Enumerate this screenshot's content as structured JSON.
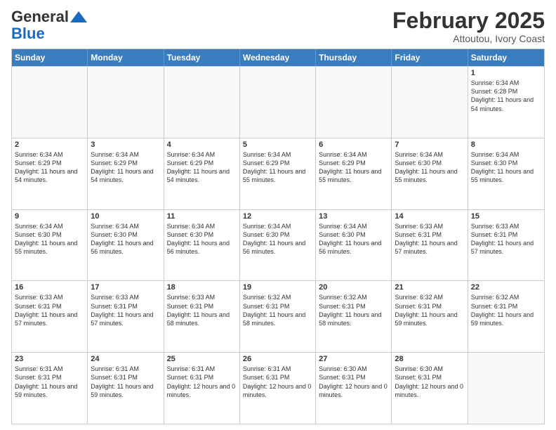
{
  "header": {
    "logo_general": "General",
    "logo_blue": "Blue",
    "month_title": "February 2025",
    "location": "Attoutou, Ivory Coast"
  },
  "days_of_week": [
    "Sunday",
    "Monday",
    "Tuesday",
    "Wednesday",
    "Thursday",
    "Friday",
    "Saturday"
  ],
  "weeks": [
    [
      {
        "day": "",
        "info": "",
        "empty": true
      },
      {
        "day": "",
        "info": "",
        "empty": true
      },
      {
        "day": "",
        "info": "",
        "empty": true
      },
      {
        "day": "",
        "info": "",
        "empty": true
      },
      {
        "day": "",
        "info": "",
        "empty": true
      },
      {
        "day": "",
        "info": "",
        "empty": true
      },
      {
        "day": "1",
        "info": "Sunrise: 6:34 AM\nSunset: 6:28 PM\nDaylight: 11 hours and 54 minutes."
      }
    ],
    [
      {
        "day": "2",
        "info": "Sunrise: 6:34 AM\nSunset: 6:29 PM\nDaylight: 11 hours and 54 minutes."
      },
      {
        "day": "3",
        "info": "Sunrise: 6:34 AM\nSunset: 6:29 PM\nDaylight: 11 hours and 54 minutes."
      },
      {
        "day": "4",
        "info": "Sunrise: 6:34 AM\nSunset: 6:29 PM\nDaylight: 11 hours and 54 minutes."
      },
      {
        "day": "5",
        "info": "Sunrise: 6:34 AM\nSunset: 6:29 PM\nDaylight: 11 hours and 55 minutes."
      },
      {
        "day": "6",
        "info": "Sunrise: 6:34 AM\nSunset: 6:29 PM\nDaylight: 11 hours and 55 minutes."
      },
      {
        "day": "7",
        "info": "Sunrise: 6:34 AM\nSunset: 6:30 PM\nDaylight: 11 hours and 55 minutes."
      },
      {
        "day": "8",
        "info": "Sunrise: 6:34 AM\nSunset: 6:30 PM\nDaylight: 11 hours and 55 minutes."
      }
    ],
    [
      {
        "day": "9",
        "info": "Sunrise: 6:34 AM\nSunset: 6:30 PM\nDaylight: 11 hours and 55 minutes."
      },
      {
        "day": "10",
        "info": "Sunrise: 6:34 AM\nSunset: 6:30 PM\nDaylight: 11 hours and 56 minutes."
      },
      {
        "day": "11",
        "info": "Sunrise: 6:34 AM\nSunset: 6:30 PM\nDaylight: 11 hours and 56 minutes."
      },
      {
        "day": "12",
        "info": "Sunrise: 6:34 AM\nSunset: 6:30 PM\nDaylight: 11 hours and 56 minutes."
      },
      {
        "day": "13",
        "info": "Sunrise: 6:34 AM\nSunset: 6:30 PM\nDaylight: 11 hours and 56 minutes."
      },
      {
        "day": "14",
        "info": "Sunrise: 6:33 AM\nSunset: 6:31 PM\nDaylight: 11 hours and 57 minutes."
      },
      {
        "day": "15",
        "info": "Sunrise: 6:33 AM\nSunset: 6:31 PM\nDaylight: 11 hours and 57 minutes."
      }
    ],
    [
      {
        "day": "16",
        "info": "Sunrise: 6:33 AM\nSunset: 6:31 PM\nDaylight: 11 hours and 57 minutes."
      },
      {
        "day": "17",
        "info": "Sunrise: 6:33 AM\nSunset: 6:31 PM\nDaylight: 11 hours and 57 minutes."
      },
      {
        "day": "18",
        "info": "Sunrise: 6:33 AM\nSunset: 6:31 PM\nDaylight: 11 hours and 58 minutes."
      },
      {
        "day": "19",
        "info": "Sunrise: 6:32 AM\nSunset: 6:31 PM\nDaylight: 11 hours and 58 minutes."
      },
      {
        "day": "20",
        "info": "Sunrise: 6:32 AM\nSunset: 6:31 PM\nDaylight: 11 hours and 58 minutes."
      },
      {
        "day": "21",
        "info": "Sunrise: 6:32 AM\nSunset: 6:31 PM\nDaylight: 11 hours and 59 minutes."
      },
      {
        "day": "22",
        "info": "Sunrise: 6:32 AM\nSunset: 6:31 PM\nDaylight: 11 hours and 59 minutes."
      }
    ],
    [
      {
        "day": "23",
        "info": "Sunrise: 6:31 AM\nSunset: 6:31 PM\nDaylight: 11 hours and 59 minutes."
      },
      {
        "day": "24",
        "info": "Sunrise: 6:31 AM\nSunset: 6:31 PM\nDaylight: 11 hours and 59 minutes."
      },
      {
        "day": "25",
        "info": "Sunrise: 6:31 AM\nSunset: 6:31 PM\nDaylight: 12 hours and 0 minutes."
      },
      {
        "day": "26",
        "info": "Sunrise: 6:31 AM\nSunset: 6:31 PM\nDaylight: 12 hours and 0 minutes."
      },
      {
        "day": "27",
        "info": "Sunrise: 6:30 AM\nSunset: 6:31 PM\nDaylight: 12 hours and 0 minutes."
      },
      {
        "day": "28",
        "info": "Sunrise: 6:30 AM\nSunset: 6:31 PM\nDaylight: 12 hours and 0 minutes."
      },
      {
        "day": "",
        "info": "",
        "empty": true
      }
    ]
  ]
}
